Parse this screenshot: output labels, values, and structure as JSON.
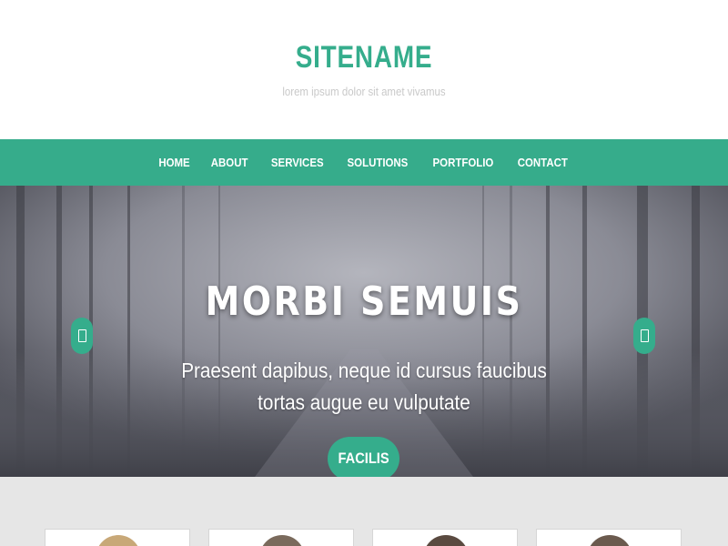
{
  "site": {
    "name": "SITENAME",
    "tagline": "lorem ipsum dolor sit amet vivamus"
  },
  "nav": {
    "items": [
      "HOME",
      "ABOUT",
      "SERVICES",
      "SOLUTIONS",
      "PORTFOLIO",
      "CONTACT"
    ]
  },
  "hero": {
    "title": "MORBI SEMUIS",
    "subtitle": "Praesent dapibus, neque id cursus faucibus tortas augue eu vulputate",
    "button_label": "FACILIS"
  },
  "colors": {
    "accent": "#35ad8c",
    "nav_bg": "#36ac8b",
    "features_bg": "#e6e6e6"
  },
  "icons": {
    "prev": "chevron-left-icon",
    "next": "chevron-right-icon"
  },
  "features": {
    "cards": [
      {
        "portrait": "blonde-woman-photo"
      },
      {
        "portrait": "man-photo"
      },
      {
        "portrait": "dark-haired-person-photo"
      },
      {
        "portrait": "woman-photo"
      }
    ]
  }
}
